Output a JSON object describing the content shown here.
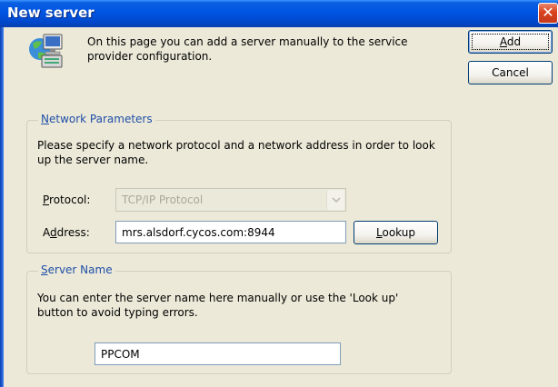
{
  "window": {
    "title": "New server",
    "close_glyph": "✕"
  },
  "intro": {
    "icon": "network-server-icon",
    "text": "On this page you can add a server manually to the service provider configuration."
  },
  "buttons": {
    "add": {
      "label_hot": "A",
      "label_rest": "dd"
    },
    "cancel": "Cancel",
    "lookup": {
      "label_hot": "L",
      "label_rest": "ookup"
    }
  },
  "network_parameters": {
    "legend_hot": "N",
    "legend_rest": "etwork Parameters",
    "description": "Please specify a network protocol and a network address in order to look up the server name.",
    "protocol_label_hot": "P",
    "protocol_label_rest": "rotocol:",
    "protocol_value": "TCP/IP Protocol",
    "address_label_pre": "A",
    "address_label_hot": "d",
    "address_label_rest": "dress:",
    "address_value": "mrs.alsdorf.cycos.com:8944"
  },
  "server_name": {
    "legend_hot": "S",
    "legend_rest": "erver Name",
    "description": "You can enter the server name here manually or use the 'Look up' button to avoid typing errors.",
    "value": "PPCOM"
  }
}
